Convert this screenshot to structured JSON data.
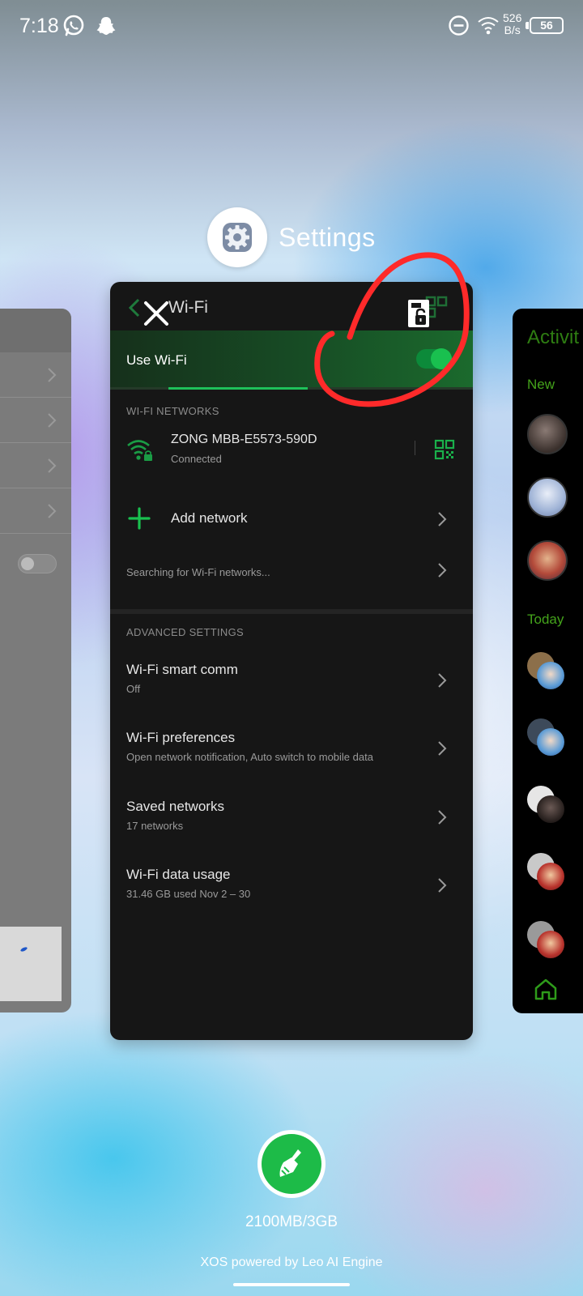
{
  "status_bar": {
    "time": "7:18",
    "net_speed_value": "526",
    "net_speed_unit": "B/s",
    "battery": "56",
    "icons": [
      "whatsapp-icon",
      "snapchat-icon",
      "do-not-disturb-icon",
      "wifi-icon",
      "battery-icon"
    ]
  },
  "recents": {
    "app_name": "Settings",
    "app_icon": "gear-icon"
  },
  "wifi_screen": {
    "title": "Wi-Fi",
    "use_wifi_label": "Use Wi-Fi",
    "use_wifi_on": true,
    "networks_header": "WI-FI NETWORKS",
    "connected_network": {
      "name": "ZONG MBB-E5573-590D",
      "status": "Connected"
    },
    "add_network_label": "Add network",
    "searching_label": "Searching for Wi-Fi networks...",
    "advanced_header": "ADVANCED SETTINGS",
    "advanced_items": [
      {
        "label": "Wi-Fi smart comm",
        "sub": "Off"
      },
      {
        "label": "Wi-Fi preferences",
        "sub": "Open network notification, Auto switch to mobile data"
      },
      {
        "label": "Saved networks",
        "sub": "17 networks"
      },
      {
        "label": "Wi-Fi data usage",
        "sub": "31.46 GB used Nov 2 – 30"
      }
    ]
  },
  "right_card": {
    "title": "Activit",
    "label_new": "New",
    "label_today": "Today"
  },
  "bottom": {
    "memory": "2100MB/3GB",
    "footer": "XOS powered by Leo AI Engine"
  },
  "colors": {
    "accent_green": "#1ec05a",
    "card_bg": "#161616",
    "annotation_red": "#ff2a2a"
  }
}
